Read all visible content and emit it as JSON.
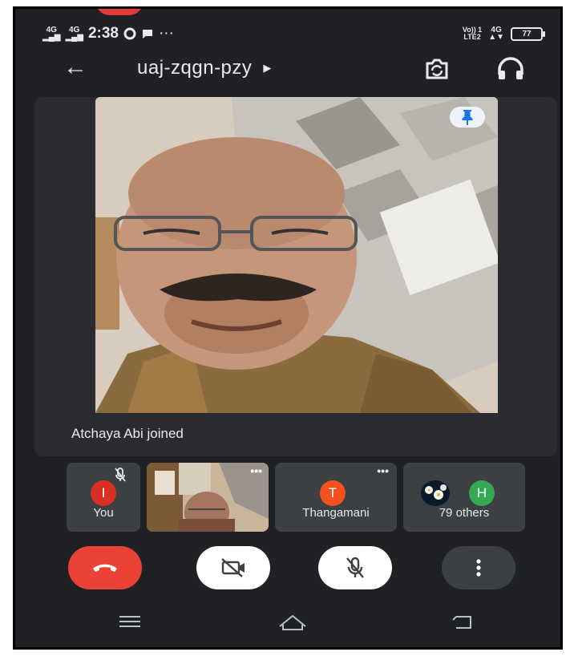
{
  "status_bar": {
    "net1": "4G",
    "net2": "4G",
    "time": "2:38",
    "more": "···",
    "carrier": "Vo)) 1\nLTE2",
    "net3": "4G",
    "battery": "77"
  },
  "meeting": {
    "code": "uaj-zqgn-pzy",
    "icons": [
      "back-arrow-icon",
      "caret-right-icon",
      "switch-camera-icon",
      "headphones-icon"
    ]
  },
  "main_video": {
    "pinned": true,
    "toast": "Atchaya Abi joined"
  },
  "participants": [
    {
      "initial": "I",
      "name": "You",
      "color": "#d93025",
      "muted": true
    },
    {
      "name": "",
      "has_video": true
    },
    {
      "initial": "T",
      "name": "Thangamani",
      "color": "#f4511e"
    },
    {
      "initial": "H",
      "name": "79 others",
      "color": "#34a853"
    }
  ],
  "controls": {
    "colors": {
      "end_call": "#ea4335",
      "toggle_bg": "#ffffff",
      "more_bg": "#3c4043"
    }
  }
}
